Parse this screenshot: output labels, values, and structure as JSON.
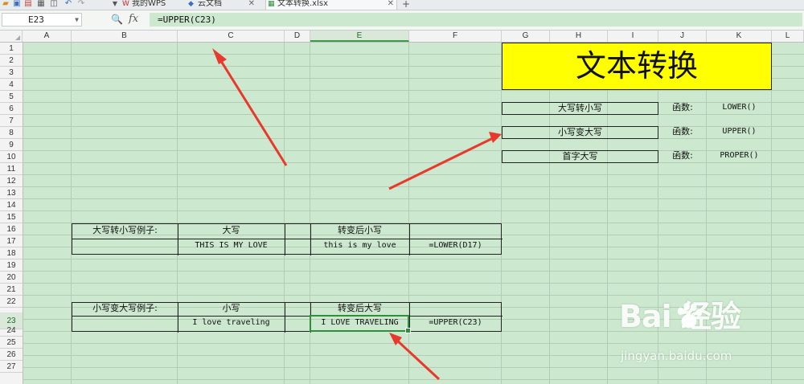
{
  "tabs": [
    {
      "label": "我的WPS"
    },
    {
      "label": "云文档"
    },
    {
      "label": "文本转换.xlsx"
    }
  ],
  "toolbar_icons": [
    "folder-icon",
    "save-icon",
    "export-icon",
    "print-icon",
    "preview-icon",
    "undo-icon",
    "redo-icon",
    "dropdown-icon"
  ],
  "new_tab_glyph": "+",
  "tab_close_glyph": "✕",
  "formula_bar": {
    "name_box": "E23",
    "zoom_glyph": "🔍",
    "fx_label": "fx",
    "formula": "=UPPER(C23)"
  },
  "columns": [
    "A",
    "B",
    "C",
    "D",
    "E",
    "F",
    "G",
    "H",
    "I",
    "J",
    "K",
    "L"
  ],
  "selected_column": "E",
  "rows": [
    "1",
    "2",
    "3",
    "4",
    "5",
    "6",
    "7",
    "8",
    "9",
    "10",
    "11",
    "12",
    "13",
    "14",
    "15",
    "16",
    "17",
    "18",
    "19",
    "20",
    "21",
    "22",
    "23",
    "24",
    "25",
    "26",
    "27"
  ],
  "selected_row": "23",
  "sheet": {
    "title": "文本转换",
    "functions": [
      {
        "label": "大写转小写",
        "prefix": "函数:",
        "name": "LOWER()"
      },
      {
        "label": "小写变大写",
        "prefix": "函数:",
        "name": "UPPER()"
      },
      {
        "label": "首字大写",
        "prefix": "函数:",
        "name": "PROPER()"
      }
    ],
    "example1": {
      "title": "大写转小写例子:",
      "col1_header": "大写",
      "col2_header": "转变后小写",
      "value1": "THIS IS MY LOVE",
      "value2": "this is my love",
      "formula": "=LOWER(D17)"
    },
    "example2": {
      "title": "小写变大写例子:",
      "col1_header": "小写",
      "col2_header": "转变后大写",
      "value1": "I love traveling",
      "value2": "I LOVE TRAVELING",
      "formula": "=UPPER(C23)"
    }
  },
  "watermark": {
    "logo": "Bai  经验",
    "url": "jingyan.baidu.com"
  },
  "colors": {
    "sheet_background": "#cce8cf",
    "title_fill": "#ffff00",
    "arrow": "#e8392c",
    "active_cell_border": "#2f8f3a"
  }
}
